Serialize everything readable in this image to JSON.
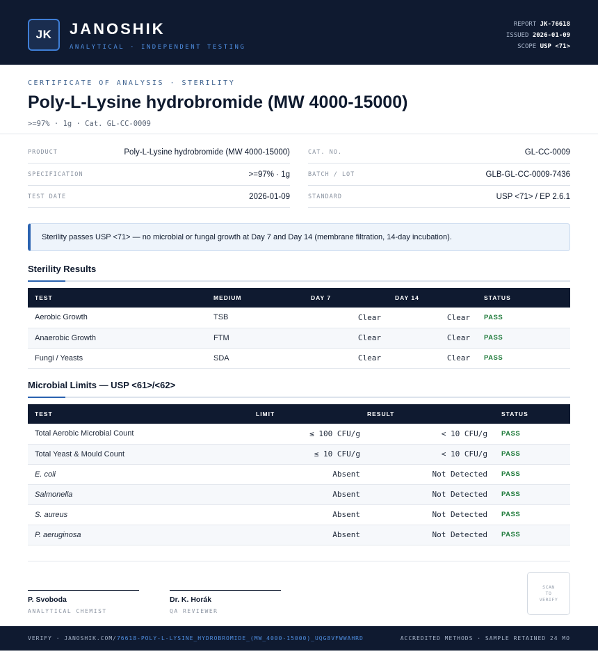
{
  "header": {
    "logo_text": "JK",
    "brand": "JANOSHIK",
    "tagline": "ANALYTICAL · INDEPENDENT TESTING",
    "report_label": "REPORT",
    "report_value": "JK-76618",
    "issued_label": "ISSUED",
    "issued_value": "2026-01-09",
    "scope_label": "SCOPE",
    "scope_value": "USP <71>"
  },
  "title_block": {
    "kicker": "CERTIFICATE OF ANALYSIS · STERILITY",
    "title": "Poly-L-Lysine hydrobromide (MW 4000-15000)",
    "subtitle": ">=97% · 1g  ·  Cat. GL-CC-0009"
  },
  "info": {
    "left": [
      {
        "label": "PRODUCT",
        "value": "Poly-L-Lysine hydrobromide (MW 4000-15000)"
      },
      {
        "label": "SPECIFICATION",
        "value": ">=97% · 1g"
      },
      {
        "label": "TEST DATE",
        "value": "2026-01-09"
      }
    ],
    "right": [
      {
        "label": "CAT. NO.",
        "value": "GL-CC-0009"
      },
      {
        "label": "BATCH / LOT",
        "value": "GLB-GL-CC-0009-7436"
      },
      {
        "label": "STANDARD",
        "value": "USP <71> / EP 2.6.1"
      }
    ]
  },
  "banner": "Sterility passes USP <71> — no microbial or fungal growth at Day 7 and Day 14 (membrane filtration, 14-day incubation).",
  "sterility": {
    "title": "Sterility Results",
    "headers": [
      "TEST",
      "MEDIUM",
      "DAY 7",
      "DAY 14",
      "STATUS"
    ],
    "rows": [
      {
        "test": "Aerobic Growth",
        "medium": "TSB",
        "day7": "Clear",
        "day14": "Clear",
        "status": "PASS"
      },
      {
        "test": "Anaerobic Growth",
        "medium": "FTM",
        "day7": "Clear",
        "day14": "Clear",
        "status": "PASS"
      },
      {
        "test": "Fungi / Yeasts",
        "medium": "SDA",
        "day7": "Clear",
        "day14": "Clear",
        "status": "PASS"
      }
    ]
  },
  "microbial": {
    "title": "Microbial Limits — USP <61>/<62>",
    "headers": [
      "TEST",
      "LIMIT",
      "RESULT",
      "STATUS"
    ],
    "rows": [
      {
        "test": "Total Aerobic Microbial Count",
        "limit": "≤ 100 CFU/g",
        "result": "< 10 CFU/g",
        "status": "PASS"
      },
      {
        "test": "Total Yeast & Mould Count",
        "limit": "≤ 10 CFU/g",
        "result": "< 10 CFU/g",
        "status": "PASS"
      },
      {
        "test": "E. coli",
        "limit": "Absent",
        "result": "Not Detected",
        "status": "PASS"
      },
      {
        "test": "Salmonella",
        "limit": "Absent",
        "result": "Not Detected",
        "status": "PASS"
      },
      {
        "test": "S. aureus",
        "limit": "Absent",
        "result": "Not Detected",
        "status": "PASS"
      },
      {
        "test": "P. aeruginosa",
        "limit": "Absent",
        "result": "Not Detected",
        "status": "PASS"
      }
    ]
  },
  "signatures": [
    {
      "name": "P. Svoboda",
      "role": "ANALYTICAL CHEMIST"
    },
    {
      "name": "Dr. K. Horák",
      "role": "QA REVIEWER"
    }
  ],
  "qr": {
    "line1": "SCAN",
    "line2": "TO",
    "line3": "VERIFY"
  },
  "footer": {
    "verify_prefix": "VERIFY · JANOSHIK.COM/",
    "verify_path": "76618-POLY-L-LYSINE_HYDROBROMIDE_(MW_4000-15000)_UQG8VFWWAHRD",
    "right": "ACCREDITED METHODS · SAMPLE RETAINED 24 MO"
  }
}
